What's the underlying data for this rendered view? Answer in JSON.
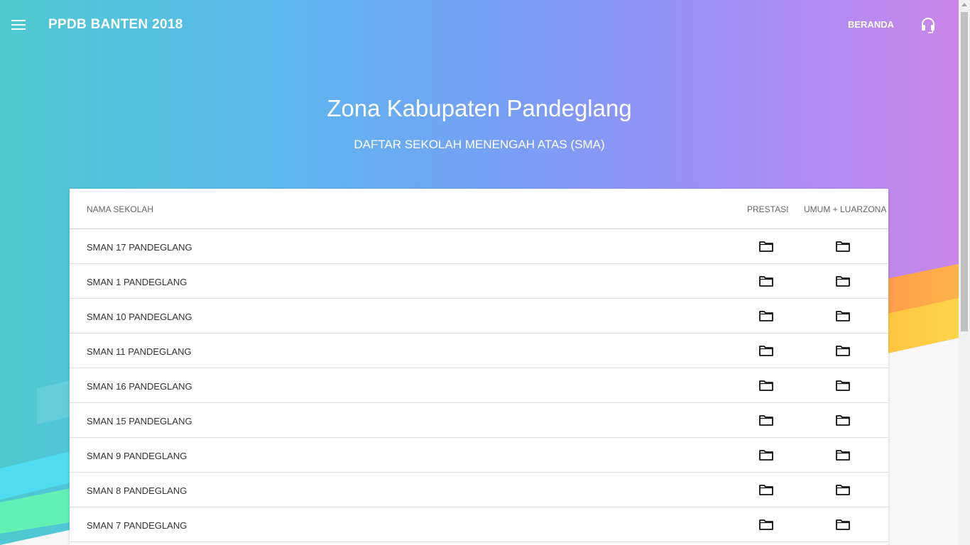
{
  "header": {
    "title": "PPDB BANTEN 2018",
    "nav_link": "BERANDA",
    "menu_icon": "hamburger-menu-icon",
    "support_icon": "headset-icon"
  },
  "hero": {
    "title": "Zona Kabupaten Pandeglang",
    "subtitle": "DAFTAR SEKOLAH MENENGAH ATAS (SMA)"
  },
  "table": {
    "columns": [
      "NAMA SEKOLAH",
      "PRESTASI",
      "UMUM + LUARZONA"
    ],
    "row_icon": "folder-icon",
    "rows": [
      {
        "name": "SMAN 17 PANDEGLANG"
      },
      {
        "name": "SMAN 1 PANDEGLANG"
      },
      {
        "name": "SMAN 10 PANDEGLANG"
      },
      {
        "name": "SMAN 11 PANDEGLANG"
      },
      {
        "name": "SMAN 16 PANDEGLANG"
      },
      {
        "name": "SMAN 15 PANDEGLANG"
      },
      {
        "name": "SMAN 9 PANDEGLANG"
      },
      {
        "name": "SMAN 8 PANDEGLANG"
      },
      {
        "name": "SMAN 7 PANDEGLANG"
      }
    ]
  },
  "colors": {
    "gradient_start": "#4ecad0",
    "gradient_mid": "#7a9cf7",
    "gradient_end": "#cb86ea",
    "text_on_hero": "#ffffff"
  }
}
